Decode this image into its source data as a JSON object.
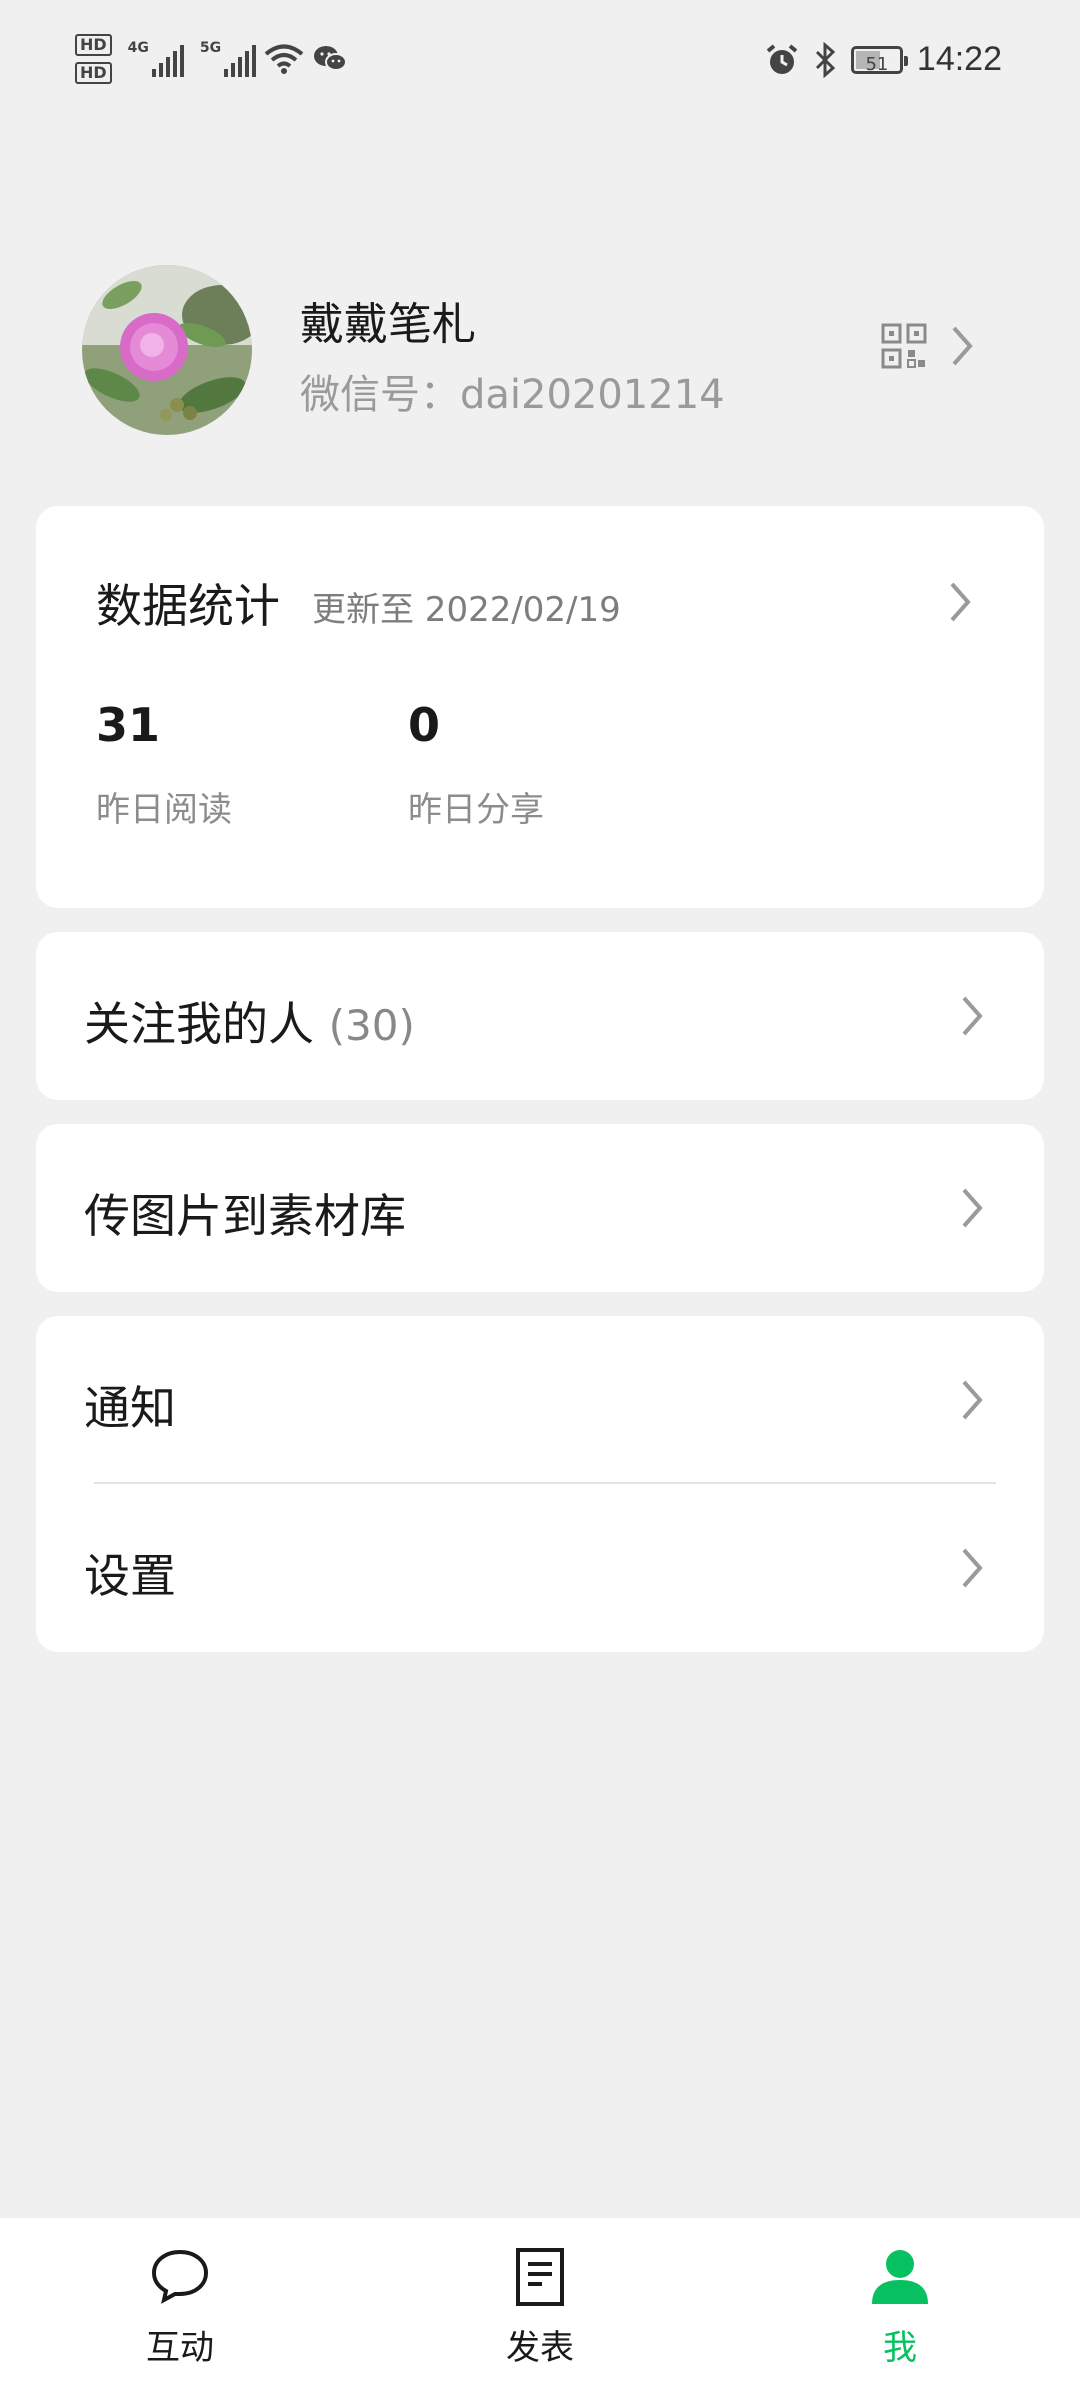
{
  "status_bar": {
    "hd1": "HD",
    "hd2": "HD",
    "net1": "4G",
    "net2": "5G",
    "battery": "51",
    "time": "14:22"
  },
  "profile": {
    "name": "戴戴笔札",
    "wechat_id": "微信号：dai20201214"
  },
  "stats": {
    "title": "数据统计",
    "updated": "更新至 2022/02/19",
    "items": [
      {
        "value": "31",
        "label": "昨日阅读"
      },
      {
        "value": "0",
        "label": "昨日分享"
      }
    ]
  },
  "menu": {
    "followers_label": "关注我的人",
    "followers_count": "(30)",
    "upload_label": "传图片到素材库",
    "notify_label": "通知",
    "settings_label": "设置"
  },
  "tabs": [
    {
      "label": "互动",
      "icon": "chat-bubble-icon"
    },
    {
      "label": "发表",
      "icon": "document-icon"
    },
    {
      "label": "我",
      "icon": "person-icon",
      "active": true
    }
  ],
  "colors": {
    "accent": "#07c160",
    "background": "#f0f0f0",
    "card": "#ffffff"
  }
}
